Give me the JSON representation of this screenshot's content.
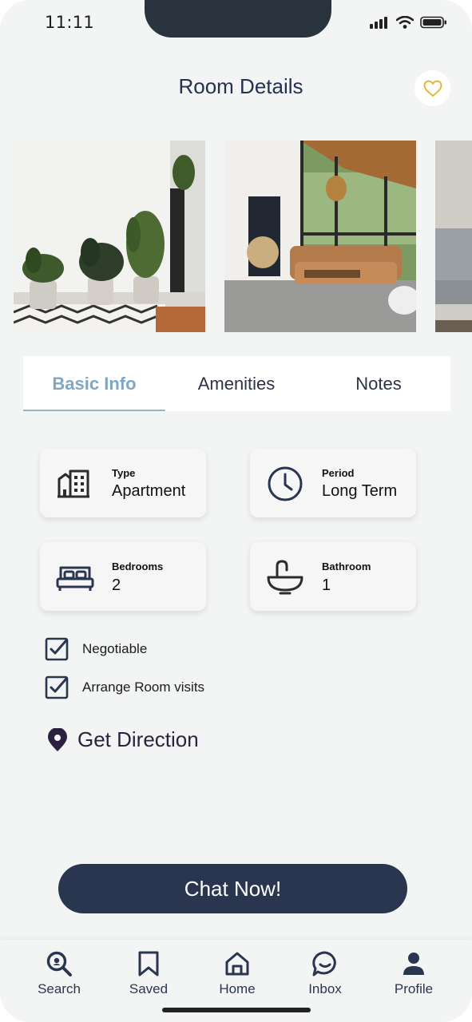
{
  "status_bar": {
    "time": "11:11"
  },
  "header": {
    "title": "Room Details",
    "favorite_icon": "heart-outline-icon",
    "accent": "#e8b53a"
  },
  "gallery": {
    "photos": [
      "plants-room-photo",
      "living-room-photo",
      "sofa-photo"
    ]
  },
  "tabs": [
    {
      "label": "Basic Info",
      "active": true
    },
    {
      "label": "Amenities",
      "active": false
    },
    {
      "label": "Notes",
      "active": false
    }
  ],
  "info": {
    "type": {
      "label": "Type",
      "value": "Apartment",
      "icon": "building-icon"
    },
    "period": {
      "label": "Period",
      "value": "Long Term",
      "icon": "clock-icon"
    },
    "bedrooms": {
      "label": "Bedrooms",
      "value": "2",
      "icon": "bed-icon"
    },
    "bathroom": {
      "label": "Bathroom",
      "value": "1",
      "icon": "sink-icon"
    }
  },
  "options": {
    "negotiable": {
      "label": "Negotiable",
      "checked": true
    },
    "visits": {
      "label": "Arrange Room visits",
      "checked": true
    }
  },
  "direction": {
    "label": "Get Direction",
    "icon": "location-pin-icon"
  },
  "chat_button": {
    "label": "Chat Now!"
  },
  "nav": [
    {
      "label": "Search",
      "icon": "search-icon"
    },
    {
      "label": "Saved",
      "icon": "bookmark-icon"
    },
    {
      "label": "Home",
      "icon": "home-icon"
    },
    {
      "label": "Inbox",
      "icon": "chat-bubble-icon"
    },
    {
      "label": "Profile",
      "icon": "profile-icon"
    }
  ],
  "colors": {
    "primary": "#2a3550",
    "tab_active": "#7fa7c3",
    "background": "#f3f4f4"
  }
}
